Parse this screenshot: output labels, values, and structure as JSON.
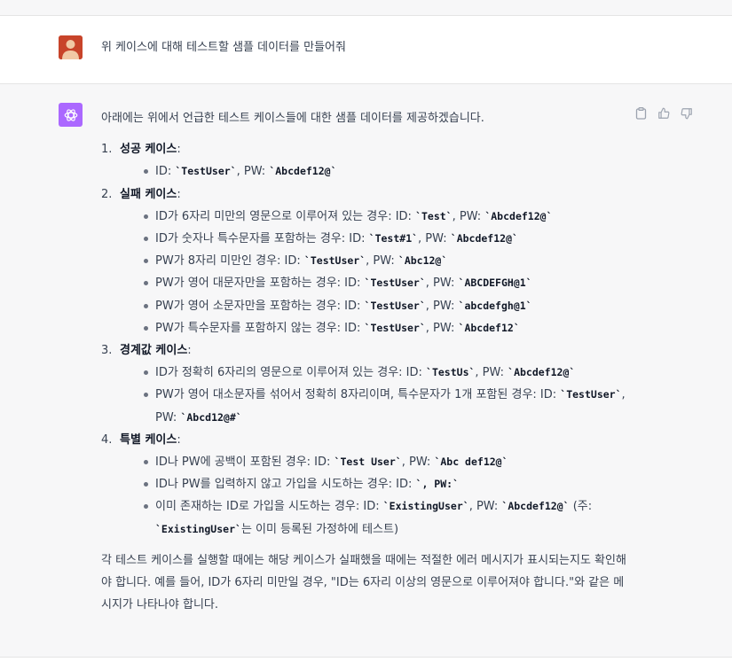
{
  "user_message": {
    "text": "위 케이스에 대해 테스트할 샘플 데이터를 만들어줘"
  },
  "assistant_message": {
    "intro": "아래에는 위에서 언급한 테스트 케이스들에 대한 샘플 데이터를 제공하겠습니다.",
    "sections": [
      {
        "number": "1.",
        "title": "성공 케이스",
        "colon": ":",
        "items": [
          {
            "text": "ID: ",
            "code1": "`TestUser`",
            "mid": ", PW: ",
            "code2": "`Abcdef12@`",
            "tail": ""
          }
        ]
      },
      {
        "number": "2.",
        "title": "실패 케이스",
        "colon": ":",
        "items": [
          {
            "text": "ID가 6자리 미만의 영문으로 이루어져 있는 경우: ID: ",
            "code1": "`Test`",
            "mid": ", PW: ",
            "code2": "`Abcdef12@`",
            "tail": ""
          },
          {
            "text": "ID가 숫자나 특수문자를 포함하는 경우: ID: ",
            "code1": "`Test#1`",
            "mid": ", PW: ",
            "code2": "`Abcdef12@`",
            "tail": ""
          },
          {
            "text": "PW가 8자리 미만인 경우: ID: ",
            "code1": "`TestUser`",
            "mid": ", PW: ",
            "code2": "`Abc12@`",
            "tail": ""
          },
          {
            "text": "PW가 영어 대문자만을 포함하는 경우: ID: ",
            "code1": "`TestUser`",
            "mid": ", PW: ",
            "code2": "`ABCDEFGH@1`",
            "tail": ""
          },
          {
            "text": "PW가 영어 소문자만을 포함하는 경우: ID: ",
            "code1": "`TestUser`",
            "mid": ", PW: ",
            "code2": "`abcdefgh@1`",
            "tail": ""
          },
          {
            "text": "PW가 특수문자를 포함하지 않는 경우: ID: ",
            "code1": "`TestUser`",
            "mid": ", PW: ",
            "code2": "`Abcdef12`",
            "tail": ""
          }
        ]
      },
      {
        "number": "3.",
        "title": "경계값 케이스",
        "colon": ":",
        "items": [
          {
            "text": "ID가 정확히 6자리의 영문으로 이루어져 있는 경우: ID: ",
            "code1": "`TestUs`",
            "mid": ", PW: ",
            "code2": "`Abcdef12@`",
            "tail": ""
          },
          {
            "text": "PW가 영어 대소문자를 섞어서 정확히 8자리이며, 특수문자가 1개 포함된 경우: ID: ",
            "code1": "`TestUser`",
            "mid": ", PW: ",
            "code2": "`Abcd12@#`",
            "tail": ""
          }
        ]
      },
      {
        "number": "4.",
        "title": "특별 케이스",
        "colon": ":",
        "items": [
          {
            "text": "ID나 PW에 공백이 포함된 경우: ID: ",
            "code1": "`Test User`",
            "mid": ", PW: ",
            "code2": "`Abc def12@`",
            "tail": ""
          },
          {
            "text": "ID나 PW를 입력하지 않고 가입을 시도하는 경우: ID: ",
            "code1": "`, PW:`",
            "mid": "",
            "code2": "",
            "tail": ""
          },
          {
            "text": "이미 존재하는 ID로 가입을 시도하는 경우: ID: ",
            "code1": "`ExistingUser`",
            "mid": ", PW: ",
            "code2": "`Abcdef12@`",
            "tail": " (주: ",
            "code3": "`ExistingUser`",
            "tail2": "는 이미 등록된 가정하에 테스트)"
          }
        ]
      }
    ],
    "outro": "각 테스트 케이스를 실행할 때에는 해당 케이스가 실패했을 때에는 적절한 에러 메시지가 표시되는지도 확인해야 합니다. 예를 들어, ID가 6자리 미만일 경우, \"ID는 6자리 이상의 영문으로 이루어져야 합니다.\"와 같은 메시지가 나타나야 합니다.",
    "actions": [
      "clipboard-icon",
      "thumbs-up-icon",
      "thumbs-down-icon"
    ]
  },
  "colors": {
    "assistant_bg": "#f7f7f8",
    "gpt_avatar": "#ab68ff",
    "user_avatar": "#c8442a"
  }
}
